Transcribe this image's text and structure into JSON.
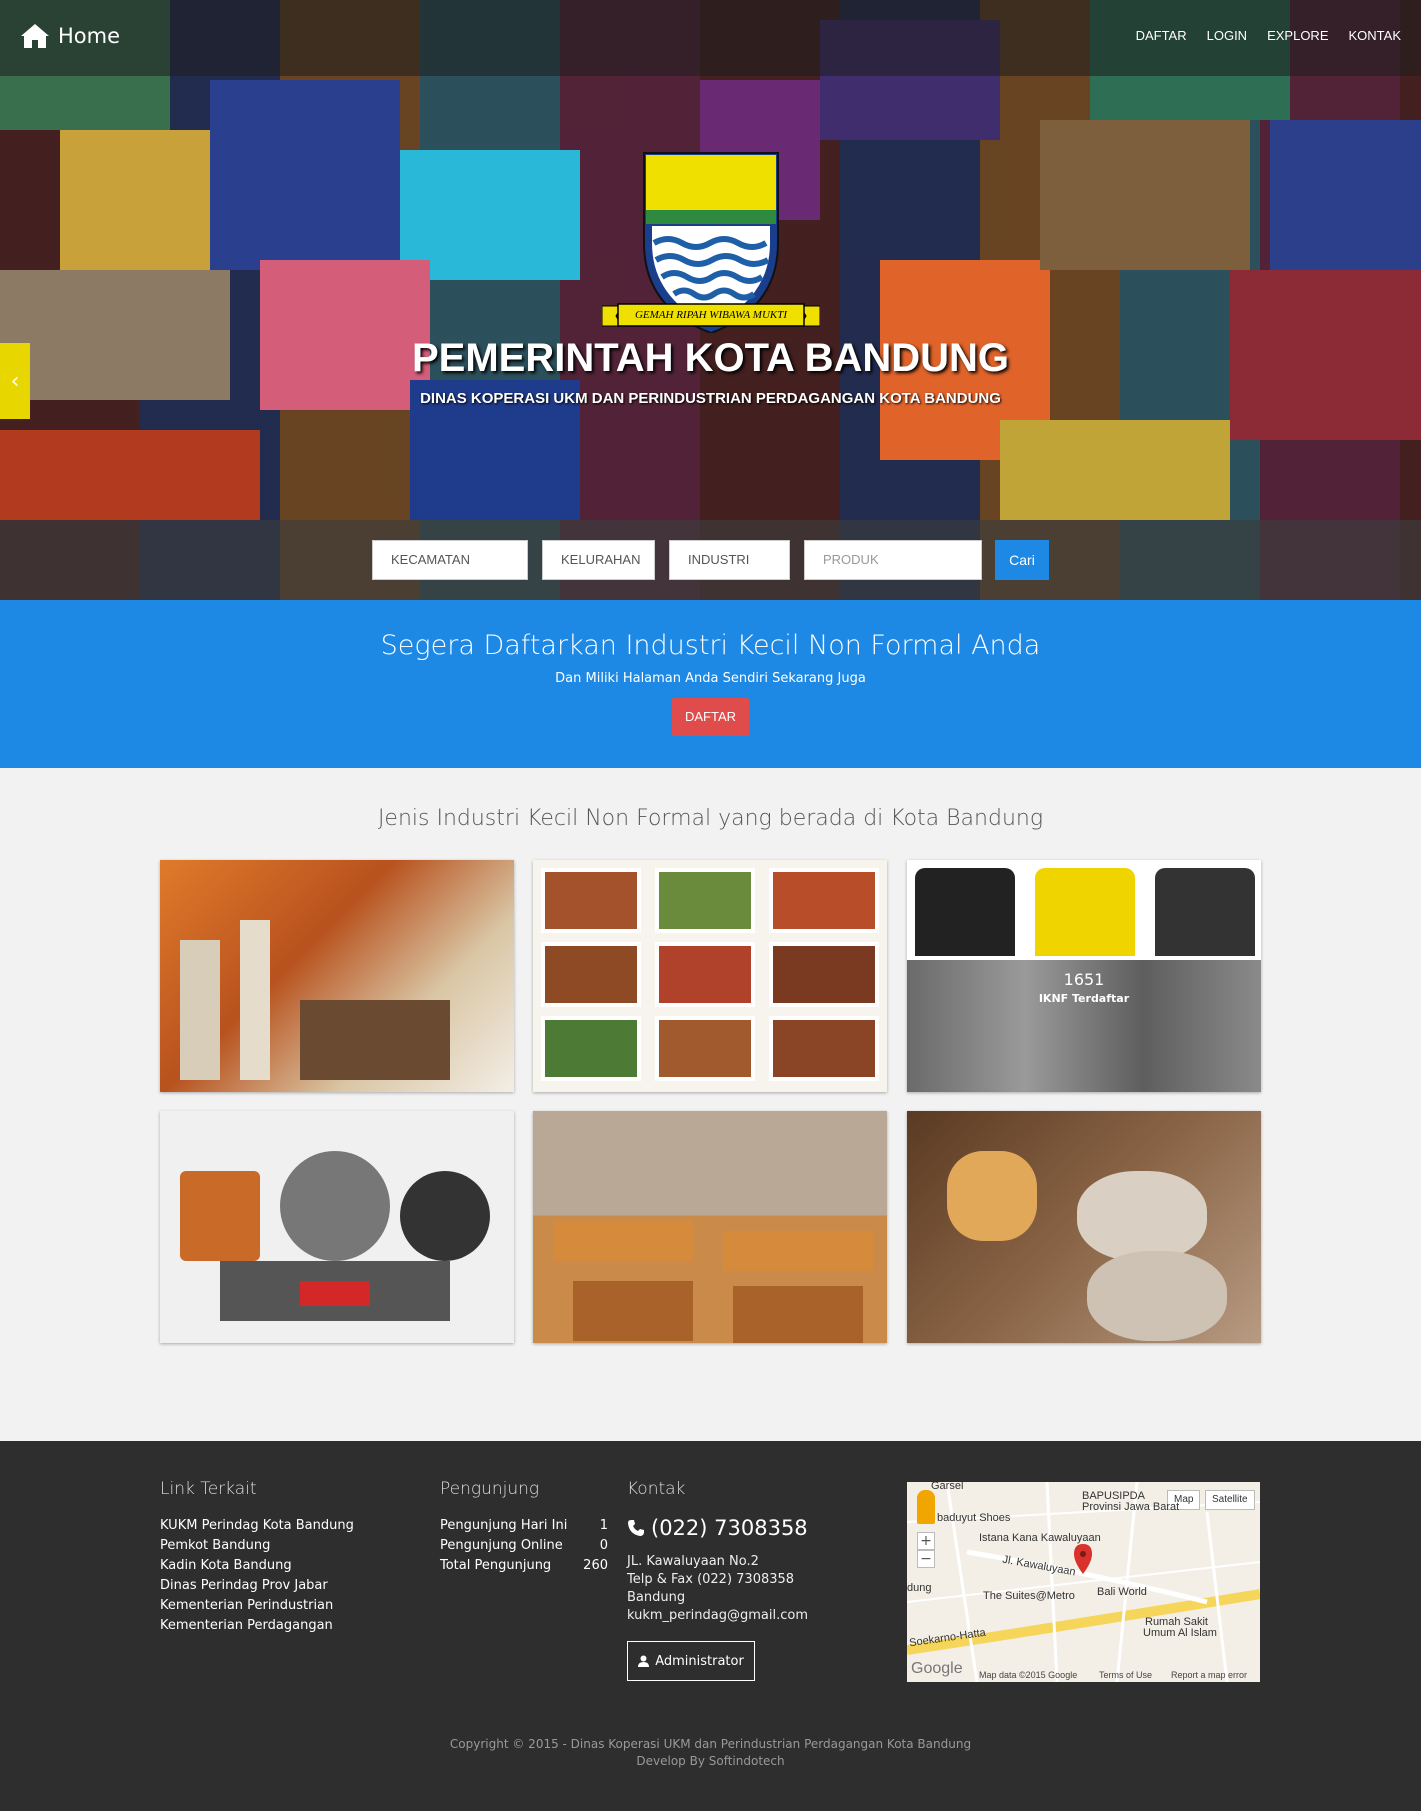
{
  "navbar": {
    "brand": "Home",
    "links": [
      "DAFTAR",
      "LOGIN",
      "EXPLORE",
      "KONTAK"
    ]
  },
  "hero": {
    "crest_motto": "GEMAH RIPAH WIBAWA MUKTI",
    "title": "PEMERINTAH KOTA BANDUNG",
    "subtitle": "DINAS KOPERASI UKM DAN PERINDUSTRIAN PERDAGANGAN KOTA BANDUNG"
  },
  "search": {
    "kecamatan": "KECAMATAN",
    "kelurahan": "KELURAHAN",
    "industri": "INDUSTRI",
    "produk_placeholder": "PRODUK",
    "button": "Cari"
  },
  "cta": {
    "title": "Segera Daftarkan Industri Kecil Non Formal Anda",
    "subtitle": "Dan Miliki Halaman Anda Sendiri Sekarang Juga",
    "button": "DAFTAR"
  },
  "gallery": {
    "title": "Jenis Industri Kecil Non Formal yang berada di Kota Bandung",
    "overlay_count": "1651",
    "overlay_label": "IKNF Terdaftar"
  },
  "footer": {
    "links_title": "Link Terkait",
    "links": [
      "KUKM Perindag Kota Bandung",
      "Pemkot Bandung",
      "Kadin Kota Bandung",
      "Dinas Perindag Prov Jabar",
      "Kementerian Perindustrian",
      "Kementerian Perdagangan"
    ],
    "visitors_title": "Pengunjung",
    "visitors": [
      {
        "label": "Pengunjung Hari Ini",
        "value": "1"
      },
      {
        "label": "Pengunjung Online",
        "value": "0"
      },
      {
        "label": "Total Pengunjung",
        "value": "260"
      }
    ],
    "contact_title": "Kontak",
    "phone": "(022) 7308358",
    "address": [
      "JL. Kawaluyaan No.2",
      "Telp & Fax (022) 7308358",
      "Bandung",
      "kukm_perindag@gmail.com"
    ],
    "admin_button": "Administrator",
    "map": {
      "btn_map": "Map",
      "btn_satellite": "Satellite",
      "labels": [
        "Garsel",
        "BAPUSIPDA",
        "Provinsi Jawa Barat",
        "baduyut Shoes",
        "Istana Kana Kawaluyaan",
        "Jl. Kawaluyaan",
        "dung",
        "The Suites@Metro",
        "Bali World",
        "Soekarno-Hatta",
        "Rumah Sakit",
        "Umum Al Islam"
      ],
      "footer": [
        "Map data ©2015 Google",
        "Terms of Use",
        "Report a map error"
      ]
    },
    "copyright": "Copyright © 2015 - Dinas Koperasi UKM dan Perindustrian Perdagangan Kota Bandung",
    "developer": "Develop By Softindotech"
  }
}
